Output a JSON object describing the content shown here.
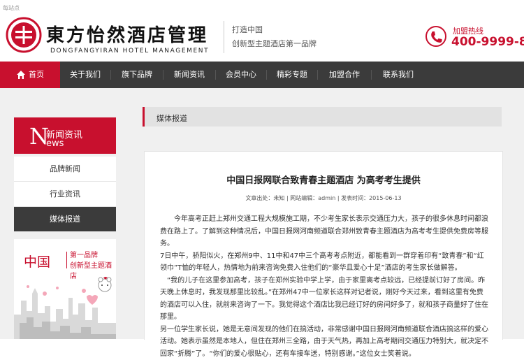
{
  "top_tip": "每站点",
  "header": {
    "logo_cn": "東方怡然酒店管理",
    "logo_en": "DONGFANGYIRAN HOTEL MANAGEMENT",
    "slogan_line1": "打造中国",
    "slogan_line2": "创新型主题酒店第一品牌",
    "hotline_label": "加盟热线",
    "hotline_number": "400-9999-821"
  },
  "nav": {
    "items": [
      "首页",
      "关于我们",
      "旗下品牌",
      "新闻资讯",
      "会员中心",
      "精彩专题",
      "加盟合作",
      "联系我们"
    ]
  },
  "sidebar": {
    "head_letter": "N",
    "head_cn": "新闻资讯",
    "head_en": "ews",
    "items": [
      "品牌新闻",
      "行业资讯",
      "媒体报道"
    ],
    "active_item": "媒体报道"
  },
  "banner": {
    "zh": "中国",
    "line1": "第一品牌",
    "line2": "创新型主题酒店"
  },
  "breadcrumb": "媒体报道",
  "article": {
    "title": "中国日报网联合致青春主题酒店 为高考考生提供",
    "meta": "文章出处：未知 | 网站编辑：admin | 发表时间：2015-06-13",
    "paragraphs": [
      "今年高考正赶上郑州交通工程大规模施工期，不少考生家长表示交通压力大，孩子的很多休息时间都浪费在路上了。了解到这种情况后，中国日报网河南频道联合郑州致青春主题酒店为高考考生提供免费房等服务。",
      "7日中午，骄阳似火，在郑州9中、11中和47中三个高考考点附近，都能看到一群穿着印有“致青春”和“红领巾”T恤的年轻人，热情地为前来咨询免费入住他们的“豪华且爱心十足”酒店的考生家长做解答。",
      "“我的儿子在这里参加高考，孩子在郑州实验中学上学，由于家里离考点较远，已经提前订好了房间。昨天晚上休息时，我发现那里比较乱。”在郑州47中一位家长这样对记者说，刚好今天过来，看到这里有免费的酒店可以入住，就前来咨询了一下。我觉得这个酒店比我已经订好的房间好多了，就和孩子商量好了住在那里。",
      "另一位学生家长说，她是无意间发现的他们在搞活动，非常感谢中国日报网河南频道联合酒店搞这样的爱心活动。她表示虽然是本地人，但住在郑州三全路，由于天气热，再加上高考期间交通压力特别大，就决定不回家“折腾”了。“你们的爱心很贴心，还有车接车送，特别感谢。”这位女士笑着说。"
    ]
  }
}
